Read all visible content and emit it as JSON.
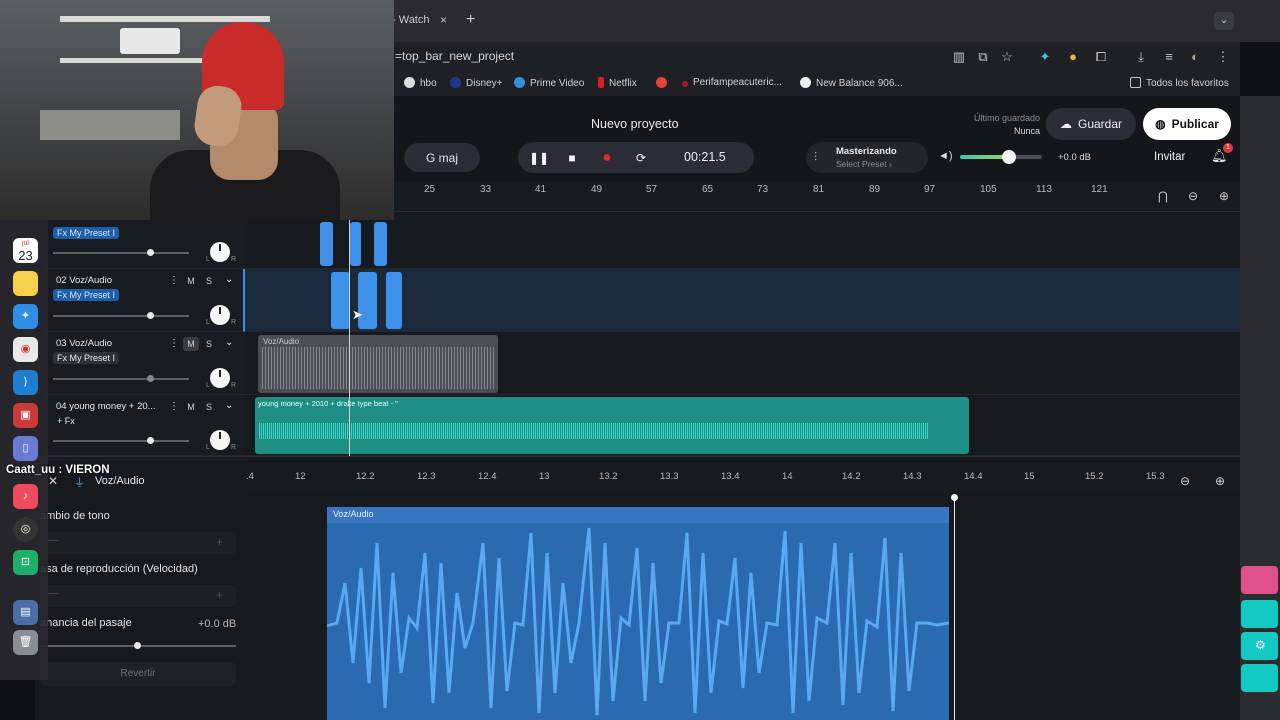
{
  "browser": {
    "tab_fragment": "- Watch",
    "tab_close": "×",
    "tab_new": "+",
    "tab_menu": "⌄",
    "url_fragment": "=top_bar_new_project",
    "bookmarks": [
      "hbo",
      "Disney+",
      "Prime Video",
      "Netflix",
      "Perifampeacuteric...",
      "New Balance 906..."
    ],
    "all_favorites": "Todos los favoritos"
  },
  "header": {
    "project_title": "Nuevo proyecto",
    "last_saved_label": "Último guardado",
    "last_saved_value": "Nunca",
    "save_label": "Guardar",
    "publish_label": "Publicar",
    "key": "G maj",
    "time": "00:21.5",
    "master_title": "Masterizando",
    "master_sub": "Select Preset ›",
    "volume_db": "+0.0 dB",
    "volume_level": 0.6,
    "invite_label": "Invitar",
    "notifications": "1"
  },
  "ruler": {
    "ticks": [
      "25",
      "33",
      "41",
      "49",
      "57",
      "65",
      "73",
      "81",
      "89",
      "97",
      "105",
      "113",
      "121"
    ]
  },
  "tracks": [
    {
      "name": "",
      "fx": "Fx My Preset I",
      "fx_active": true
    },
    {
      "name": "02 Voz/Audio",
      "fx": "Fx My Preset I",
      "fx_active": true,
      "m": "M",
      "s": "S"
    },
    {
      "name": "03 Voz/Audio",
      "fx": "Fx My Preset I",
      "fx_active": false,
      "m": "M",
      "s": "S"
    },
    {
      "name": "04 young money + 20...",
      "fx": "+ Fx",
      "fx_active": false,
      "m": "M",
      "s": "S"
    }
  ],
  "knob_l": "L",
  "knob_r": "R",
  "clips": {
    "track3_label": "Voz/Audio",
    "track4_label": "young money + 2010 + drake type beat - \""
  },
  "editor": {
    "title": "Voz/Audio",
    "pitch_label": "ambio de tono",
    "rate_label": "asa de reproducción (Velocidad)",
    "gain_label": "anancia del pasaje",
    "gain_value": "+0.0 dB",
    "revert_label": "Revertir",
    "minus": "—",
    "plus": "+",
    "clip_label": "Voz/Audio",
    "ticks": [
      ".4",
      "12",
      "12.2",
      "12.3",
      "12.4",
      "13",
      "13.2",
      "13.3",
      "13.4",
      "14",
      "14.2",
      "14.3",
      "14.4",
      "15",
      "15.2",
      "15.3"
    ]
  },
  "overlay": {
    "chat_text": "Caatt_uu : VIERON",
    "calendar_day": "23",
    "calendar_month": "jul"
  },
  "colors": {
    "accent_blue": "#3d91e8",
    "accent_teal": "#35d6c4",
    "record_red": "#e02a2a"
  }
}
